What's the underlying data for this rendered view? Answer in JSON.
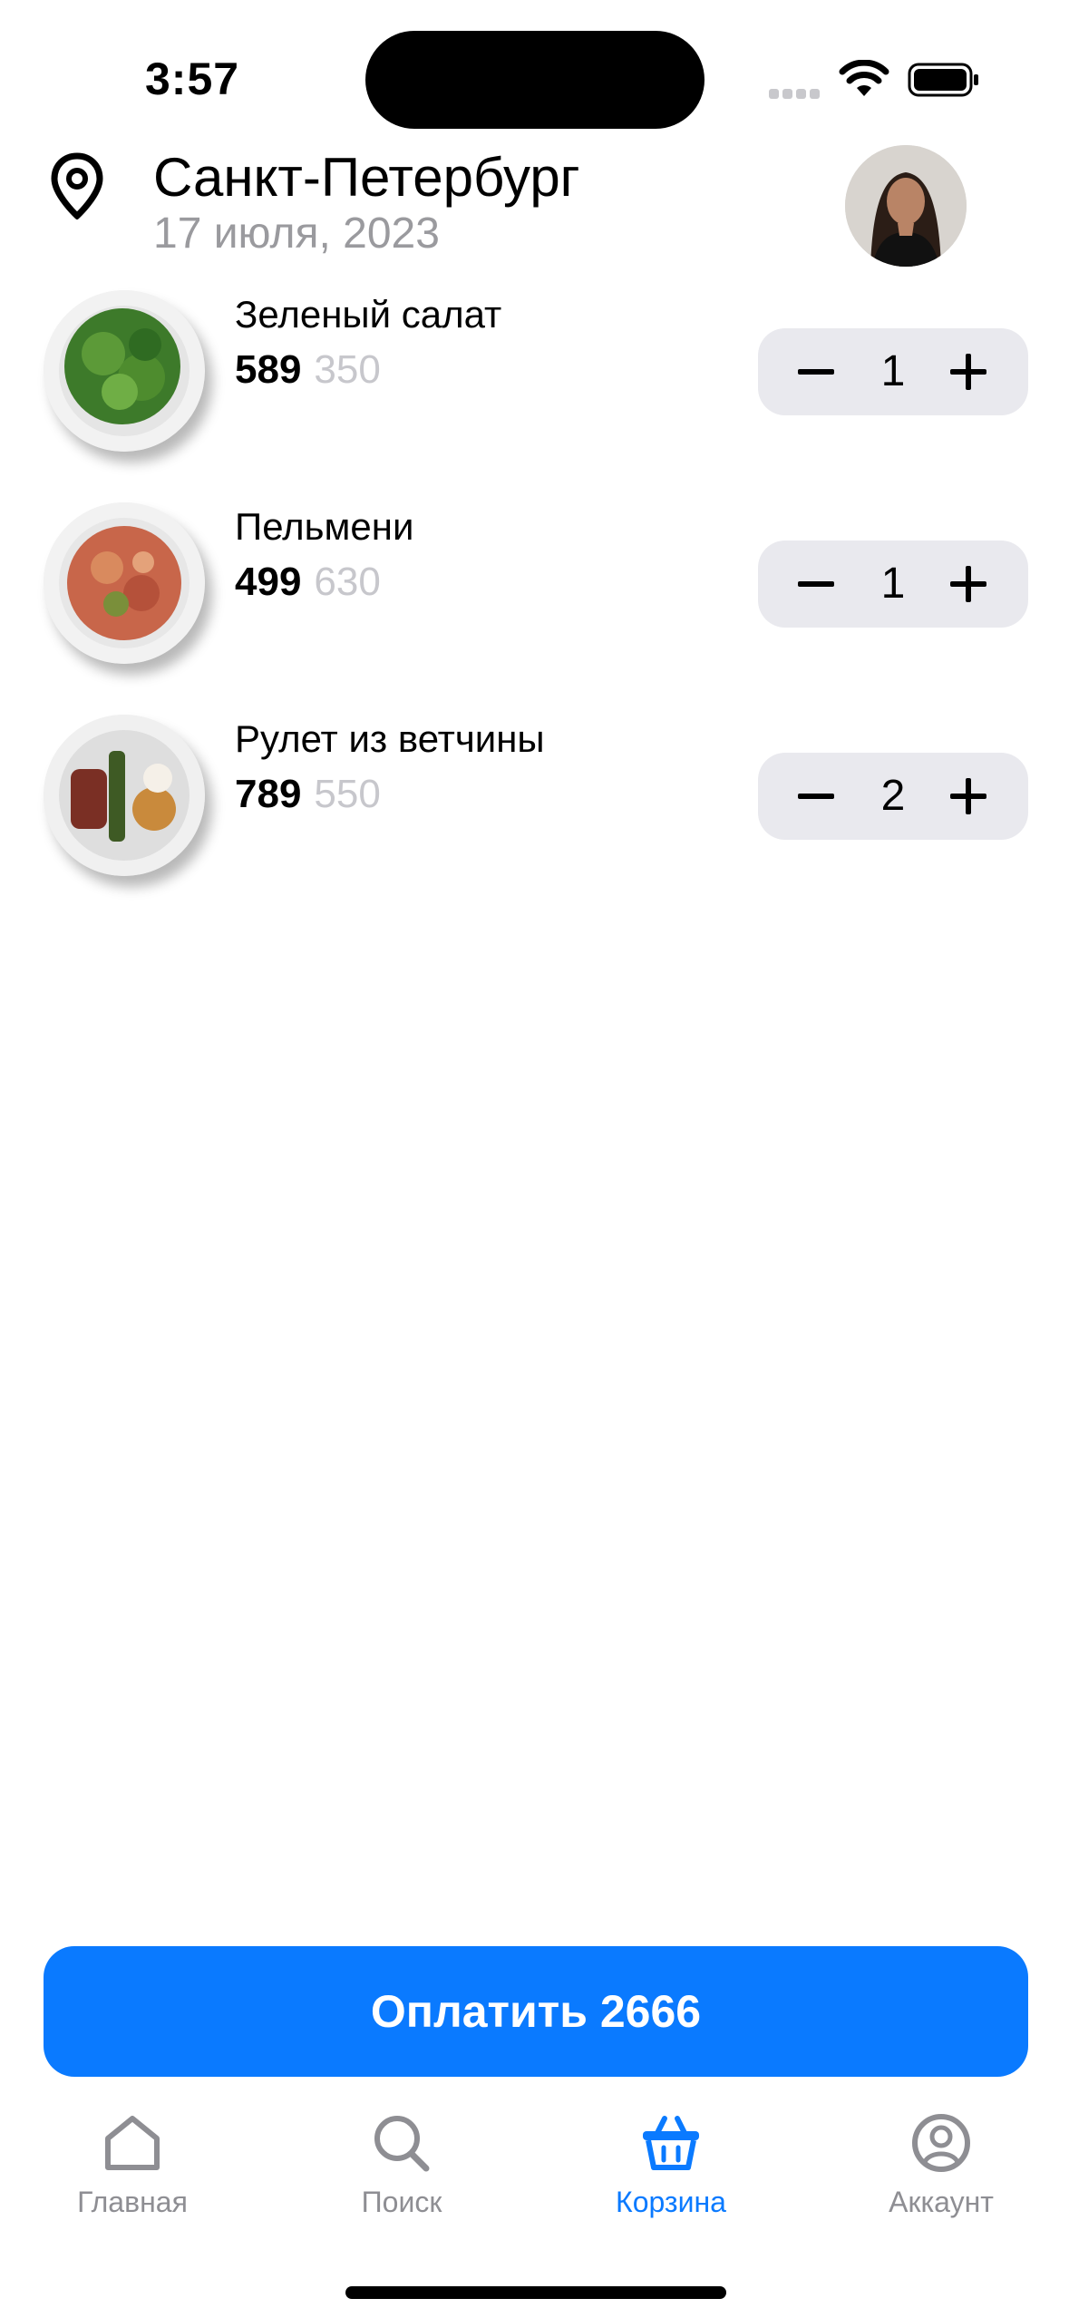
{
  "status_bar": {
    "time": "3:57"
  },
  "header": {
    "city": "Санкт-Петербург",
    "date": "17 июля, 2023"
  },
  "cart": {
    "items": [
      {
        "name": "Зеленый салат",
        "price": "589",
        "old_price": "350",
        "quantity": "1"
      },
      {
        "name": "Пельмени",
        "price": "499",
        "old_price": "630",
        "quantity": "1"
      },
      {
        "name": "Рулет из ветчины",
        "price": "789",
        "old_price": "550",
        "quantity": "2"
      }
    ]
  },
  "pay_button": {
    "label": "Оплатить 2666"
  },
  "tabs": [
    {
      "label": "Главная",
      "icon": "home-icon",
      "active": false
    },
    {
      "label": "Поиск",
      "icon": "search-icon",
      "active": false
    },
    {
      "label": "Корзина",
      "icon": "basket-icon",
      "active": true
    },
    {
      "label": "Аккаунт",
      "icon": "account-icon",
      "active": false
    }
  ],
  "colors": {
    "accent": "#0a7aff",
    "inactive": "#8e8e93",
    "stepper_bg": "#e9e9ee",
    "old_price": "#c7c7cc"
  }
}
